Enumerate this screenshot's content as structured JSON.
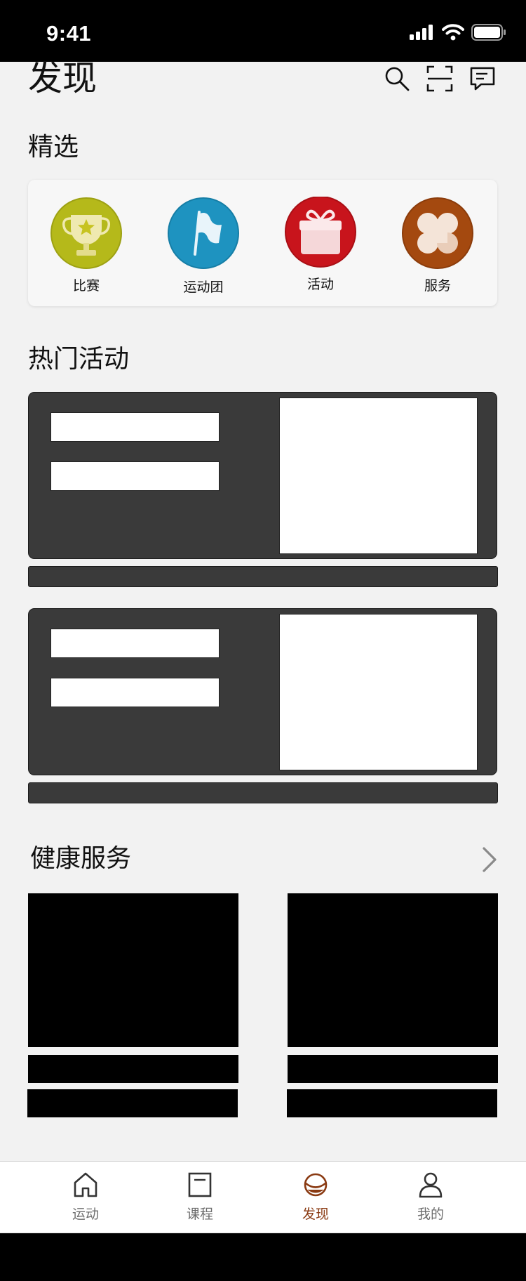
{
  "status_bar": {
    "time": "9:41"
  },
  "header": {
    "title": "发现",
    "icons": [
      "search-icon",
      "scan-icon",
      "message-icon"
    ]
  },
  "featured": {
    "title": "精选",
    "items": [
      {
        "label": "比赛",
        "icon": "trophy-icon",
        "color": "#b5b91a"
      },
      {
        "label": "运动团",
        "icon": "flag-icon",
        "color": "#1e93c0"
      },
      {
        "label": "活动",
        "icon": "gift-icon",
        "color": "#c8141c"
      },
      {
        "label": "服务",
        "icon": "clover-icon",
        "color": "#a4490f"
      }
    ]
  },
  "hot_activities": {
    "title": "热门活动"
  },
  "health_services": {
    "title": "健康服务"
  },
  "tab_bar": {
    "active": 2,
    "active_color": "#8a3a12",
    "tabs": [
      {
        "label": "运动",
        "icon": "home-icon"
      },
      {
        "label": "课程",
        "icon": "course-icon"
      },
      {
        "label": "发现",
        "icon": "discover-icon"
      },
      {
        "label": "我的",
        "icon": "profile-icon"
      }
    ]
  }
}
